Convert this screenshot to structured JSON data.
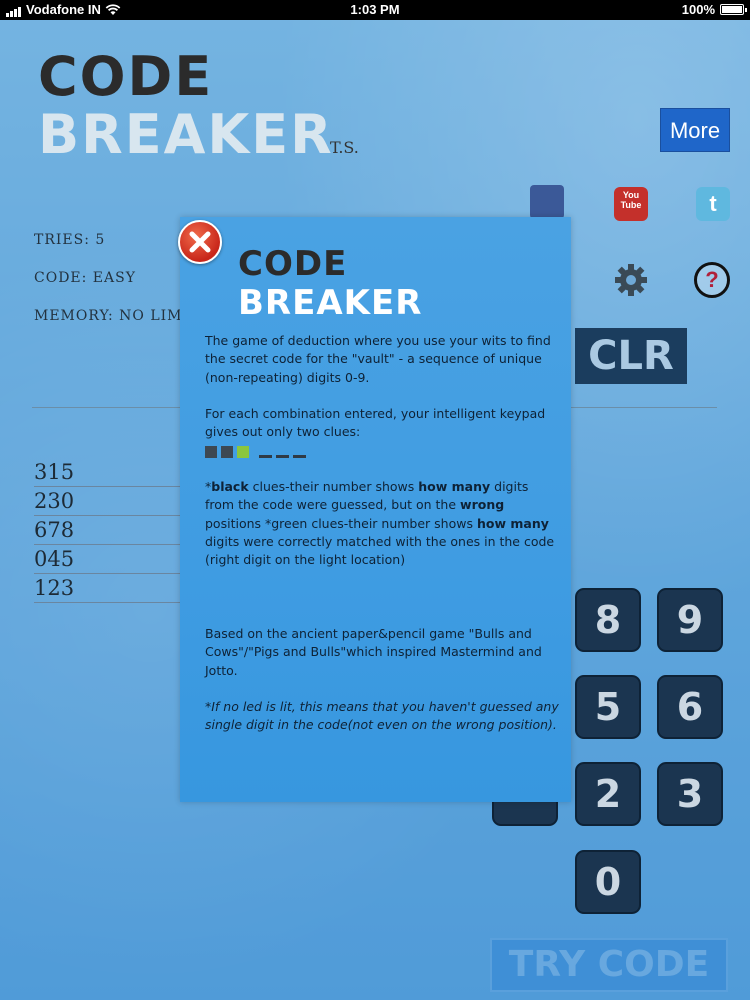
{
  "status_bar": {
    "carrier": "Vodafone IN",
    "time": "1:03 PM",
    "battery": "100%"
  },
  "app": {
    "logo_line1": "CODE",
    "logo_line2": "BREAKER",
    "logo_suffix": "T.S.",
    "more_label": "More",
    "tries": "TRIES: 5",
    "code": "CODE: EASY",
    "memory": "MEMORY: NO LIM",
    "clr_label": "CLR",
    "guesses": [
      "315",
      "230",
      "678",
      "045",
      "123"
    ],
    "keypad": [
      "8",
      "9",
      "5",
      "6",
      "2",
      "3",
      "0"
    ],
    "try_label": "TRY CODE",
    "social": {
      "youtube_text": "You Tube",
      "twitter_text": "t"
    },
    "help_symbol": "?"
  },
  "modal": {
    "title_line1": "CODE",
    "title_line2": "BREAKER",
    "para1": "The game of deduction where you use your wits to find the secret code for the \"vault\" - a sequence of unique (non-repeating) digits 0-9.",
    "para2": "For each combination entered, your intelligent keypad gives out only two clues:",
    "clues": [
      {
        "kind": "square",
        "color": "#3d4852"
      },
      {
        "kind": "square",
        "color": "#3d4852"
      },
      {
        "kind": "square",
        "color": "#8bc63e"
      },
      {
        "kind": "dash"
      },
      {
        "kind": "dash"
      },
      {
        "kind": "dash"
      }
    ],
    "para3_a": "*",
    "para3_b1": "black",
    "para3_c": " clues-their number shows ",
    "para3_d": "how many",
    "para3_e": " digits from the code were guessed, but on the ",
    "para3_f": "wrong",
    "para3_g": " positions *green clues-their number shows ",
    "para3_h": "how many",
    "para3_i": " digits were correctly matched with the ones in the code (right digit on the light location)",
    "para4": "Based on the ancient paper&pencil game \"Bulls and Cows\"/\"Pigs and Bulls\"which inspired Mastermind and Jotto.",
    "para5": "*If no led is lit, this means that you haven't guessed any single digit in the code(not even on the wrong position).",
    "colors": {
      "panel": "#3f9ce2",
      "close": "#c8261a",
      "green_clue": "#8bc63e"
    }
  }
}
